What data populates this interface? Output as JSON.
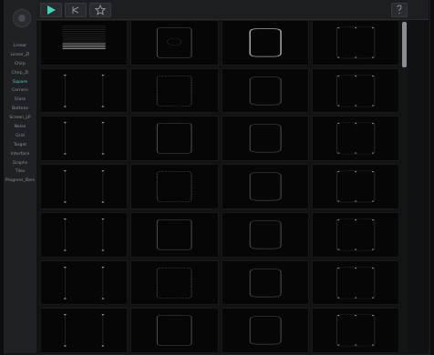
{
  "sidebar": {
    "items": [
      {
        "label": "Linear"
      },
      {
        "label": "Linear_ZI"
      },
      {
        "label": "Chirp"
      },
      {
        "label": "Chirp_ZI"
      },
      {
        "label": "Square",
        "active": true
      },
      {
        "label": "Corners"
      },
      {
        "label": "Glass"
      },
      {
        "label": "Buttons"
      },
      {
        "label": "Screen_LP"
      },
      {
        "label": "Noise"
      },
      {
        "label": "Grid"
      },
      {
        "label": "Target"
      },
      {
        "label": "Interface"
      },
      {
        "label": "Graphs"
      },
      {
        "label": "Tiles"
      },
      {
        "label": "Progress_Bars"
      }
    ]
  },
  "toolbar": {
    "play_icon": "play-icon",
    "tool_icon": "tool-icon",
    "star_icon": "star-icon",
    "help_icon": "help-icon"
  },
  "colors": {
    "accent": "#3fd6b4",
    "background": "#111214",
    "cell": "#060606"
  }
}
